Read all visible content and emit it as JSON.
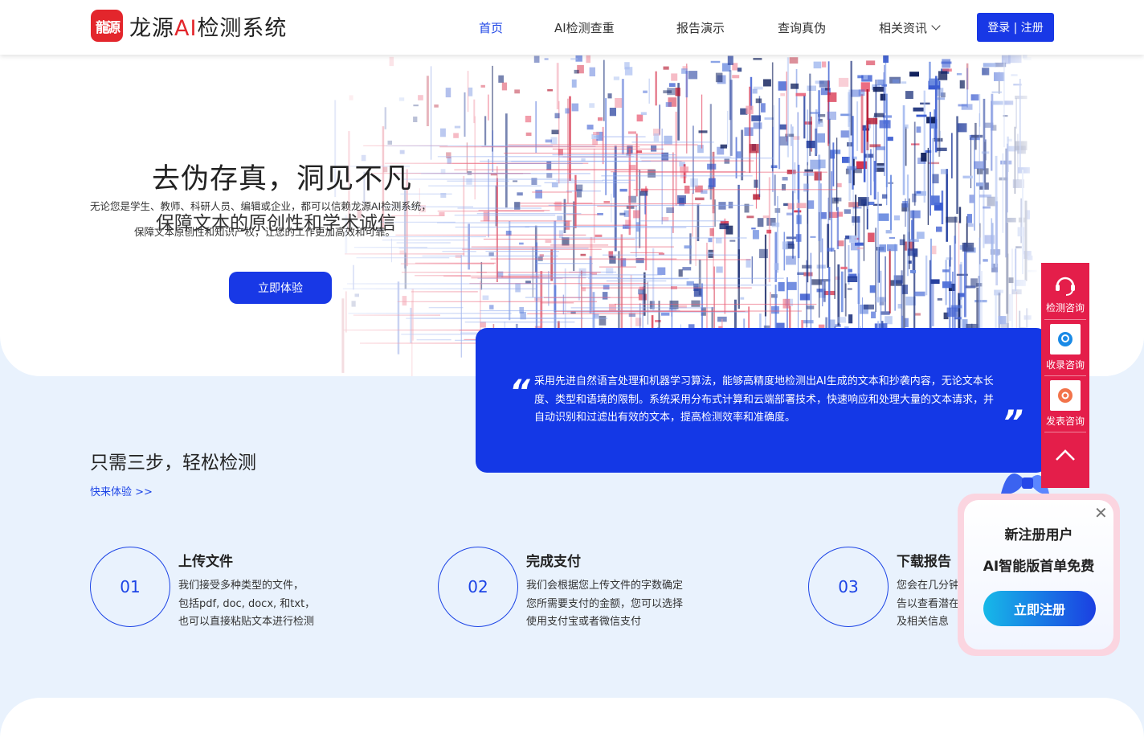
{
  "brand": {
    "mark": "龍源",
    "name_prefix": "龙源",
    "name_ai": "AI",
    "name_suffix": "检测系统",
    "accent": "#1838e6",
    "red": "#e3262c"
  },
  "nav": {
    "items": [
      "首页",
      "AI检测查重",
      "报告演示",
      "查询真伪",
      "相关资讯"
    ],
    "active": "首页",
    "login": "登录 | 注册"
  },
  "hero": {
    "title": "去伪存真，洞见不凡",
    "subtitle": "保障文本的原创性和学术诚信",
    "desc_line1": "无论您是学生、教师、科研人员、编辑或企业，都可以信赖龙源AI检测系统，",
    "desc_line2": "保障文本原创性和知识产权，让您的工作更加高效和可靠。",
    "cta": "立即体验"
  },
  "quote": {
    "open": "“",
    "close": "”",
    "text": "采用先进自然语言处理和机器学习算法，能够高精度地检测出AI生成的文本和抄袭内容，无论文本长度、类型和语境的限制。系统采用分布式计算和云端部署技术，快速响应和处理大量的文本请求，并自动识别和过滤出有效的文本，提高检测效率和准确度。"
  },
  "steps": {
    "title": "只需三步，轻松检测",
    "link": "快来体验 >>",
    "items": [
      {
        "num": "01",
        "title": "上传文件",
        "lines": [
          "我们接受多种类型的文件，",
          "包括pdf, doc, docx, 和txt，",
          "也可以直接粘贴文本进行检测"
        ]
      },
      {
        "num": "02",
        "title": "完成支付",
        "lines": [
          "我们会根据您上传文件的字数确定",
          "您所需要支付的金额，您可以选择",
          "使用支付宝或者微信支付"
        ]
      },
      {
        "num": "03",
        "title": "下载报告",
        "lines": [
          "您会在几分钟",
          "告以查看潜在",
          "及相关信息"
        ]
      }
    ]
  },
  "float_bar": {
    "items": [
      {
        "icon": "headset-icon",
        "label": "检测咨询"
      },
      {
        "icon": "chat-icon",
        "label": "收录咨询"
      },
      {
        "icon": "publish-icon",
        "label": "发表咨询"
      }
    ],
    "top_icon": "chevron-up-icon"
  },
  "popup": {
    "line1": "新注册用户",
    "line2": "AI智能版首单免费",
    "button": "立即注册",
    "close": "✕"
  }
}
